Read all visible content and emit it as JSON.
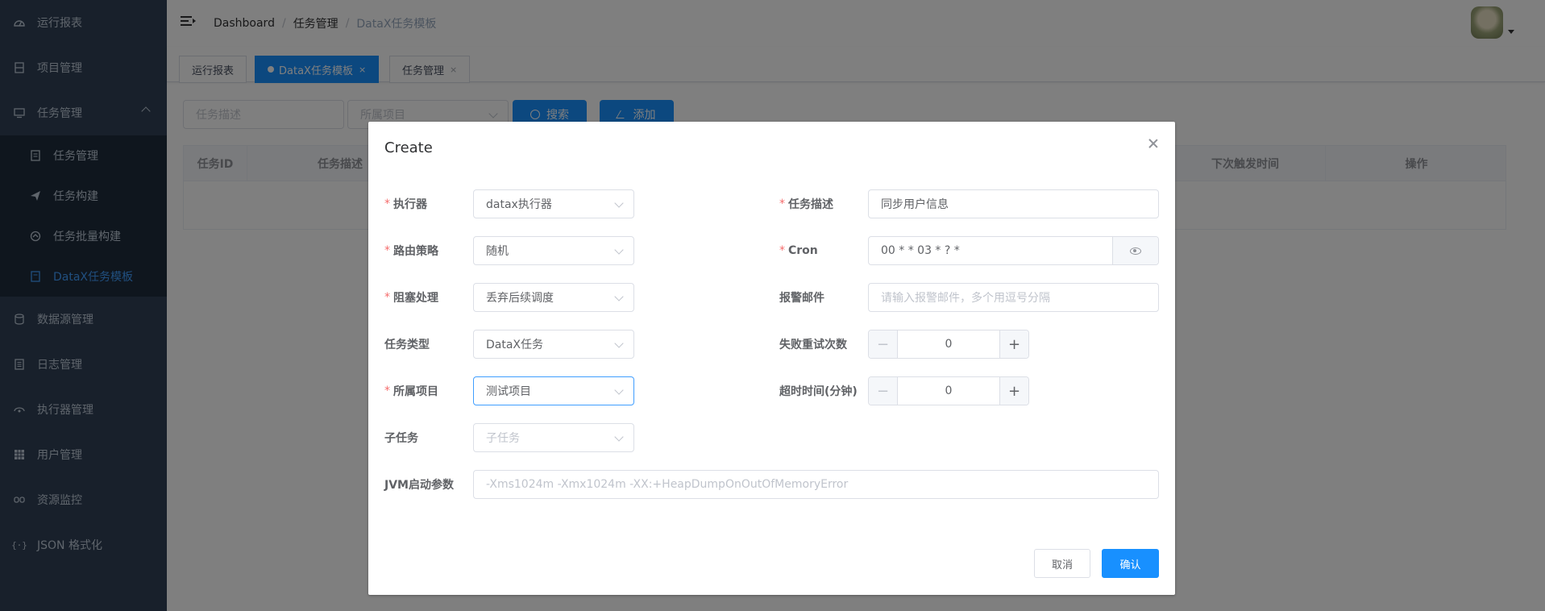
{
  "sidebar": {
    "items": [
      {
        "label": "运行报表",
        "icon": "dashboard-icon"
      },
      {
        "label": "项目管理",
        "icon": "project-icon"
      },
      {
        "label": "任务管理",
        "icon": "monitor-icon"
      },
      {
        "label": "数据源管理",
        "icon": "datasource-icon"
      },
      {
        "label": "日志管理",
        "icon": "log-icon"
      },
      {
        "label": "执行器管理",
        "icon": "executor-icon"
      },
      {
        "label": "用户管理",
        "icon": "user-table-icon"
      },
      {
        "label": "资源监控",
        "icon": "monitor-link-icon"
      },
      {
        "label": "JSON 格式化",
        "icon": "json-icon"
      }
    ],
    "submenu": [
      {
        "label": "任务管理",
        "icon": "task-doc-icon"
      },
      {
        "label": "任务构建",
        "icon": "send-icon"
      },
      {
        "label": "任务批量构建",
        "icon": "batch-icon"
      },
      {
        "label": "DataX任务模板",
        "icon": "template-icon"
      }
    ],
    "active_item": "DataX任务模板"
  },
  "navbar": {
    "breadcrumb": [
      "Dashboard",
      "任务管理",
      "DataX任务模板"
    ],
    "breadcrumb_sep": "/"
  },
  "tags": {
    "items": [
      "运行报表",
      "DataX任务模板",
      "任务管理"
    ],
    "close": "×",
    "active": "DataX任务模板"
  },
  "filter": {
    "desc_placeholder": "任务描述",
    "project_placeholder": "所属项目",
    "search_label": "搜索",
    "add_label": "添加"
  },
  "table": {
    "headers": [
      "任务ID",
      "任务描述",
      "下次触发时间",
      "操作"
    ]
  },
  "dialog": {
    "title": "Create",
    "left": [
      {
        "label": "执行器",
        "required": true,
        "value": "datax执行器",
        "placeholder": ""
      },
      {
        "label": "路由策略",
        "required": true,
        "value": "随机",
        "placeholder": ""
      },
      {
        "label": "阻塞处理",
        "required": true,
        "value": "丢弃后续调度",
        "placeholder": ""
      },
      {
        "label": "任务类型",
        "required": false,
        "value": "DataX任务",
        "placeholder": ""
      },
      {
        "label": "所属项目",
        "required": true,
        "value": "测试项目",
        "placeholder": ""
      },
      {
        "label": "子任务",
        "required": false,
        "value": "",
        "placeholder": "子任务"
      }
    ],
    "right": {
      "desc": {
        "label": "任务描述",
        "required": true,
        "value": "同步用户信息"
      },
      "cron": {
        "label": "Cron",
        "required": true,
        "value": "00 * * 03 * ? *"
      },
      "email": {
        "label": "报警邮件",
        "placeholder": "请输入报警邮件，多个用逗号分隔"
      },
      "retry": {
        "label": "失败重试次数",
        "value": "0"
      },
      "timeout": {
        "label": "超时时间(分钟)",
        "value": "0"
      }
    },
    "jvm": {
      "label": "JVM启动参数",
      "placeholder": "-Xms1024m -Xmx1024m -XX:+HeapDumpOnOutOfMemoryError"
    },
    "stepper": {
      "minus": "−",
      "plus": "+"
    },
    "required_mark": "*",
    "cancel_label": "取消",
    "confirm_label": "确认"
  },
  "colors": {
    "sidebar_bg": "#304156",
    "submenu_bg": "#1f2d3d",
    "primary": "#1890ff",
    "active_menu": "#409eff",
    "required": "#f56c6c"
  }
}
